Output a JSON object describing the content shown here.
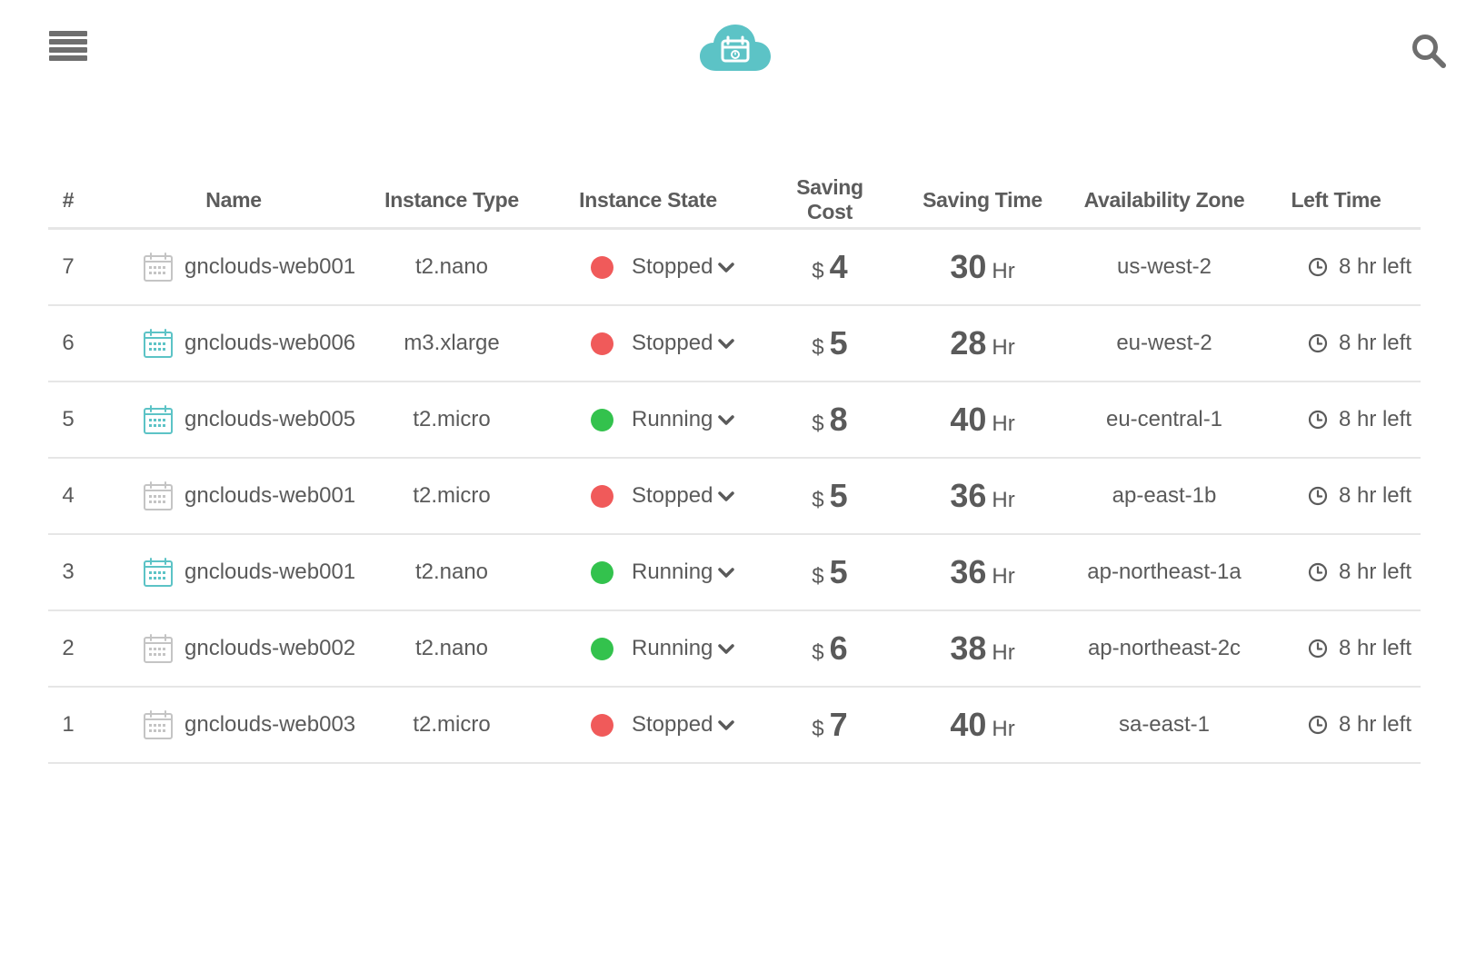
{
  "header": {
    "menu_icon": "hamburger-menu-icon",
    "logo_icon": "cloud-calendar-logo",
    "search_icon": "search-icon",
    "brand_color": "#5cc3c6"
  },
  "table": {
    "columns": [
      "#",
      "Name",
      "Instance Type",
      "Instance State",
      "Saving Cost",
      "Saving Time",
      "Availability Zone",
      "Left Time"
    ],
    "rows": [
      {
        "num": "7",
        "calendar_active": false,
        "name": "gnclouds-web001",
        "type": "t2.nano",
        "state": "Stopped",
        "cost_symbol": "$",
        "cost": "4",
        "time": "30",
        "time_unit": "Hr",
        "zone": "us-west-2",
        "left": "8 hr left"
      },
      {
        "num": "6",
        "calendar_active": true,
        "name": "gnclouds-web006",
        "type": "m3.xlarge",
        "state": "Stopped",
        "cost_symbol": "$",
        "cost": "5",
        "time": "28",
        "time_unit": "Hr",
        "zone": "eu-west-2",
        "left": "8 hr left"
      },
      {
        "num": "5",
        "calendar_active": true,
        "name": "gnclouds-web005",
        "type": "t2.micro",
        "state": "Running",
        "cost_symbol": "$",
        "cost": "8",
        "time": "40",
        "time_unit": "Hr",
        "zone": "eu-central-1",
        "left": "8 hr left"
      },
      {
        "num": "4",
        "calendar_active": false,
        "name": "gnclouds-web001",
        "type": "t2.micro",
        "state": "Stopped",
        "cost_symbol": "$",
        "cost": "5",
        "time": "36",
        "time_unit": "Hr",
        "zone": "ap-east-1b",
        "left": "8 hr left"
      },
      {
        "num": "3",
        "calendar_active": true,
        "name": "gnclouds-web001",
        "type": "t2.nano",
        "state": "Running",
        "cost_symbol": "$",
        "cost": "5",
        "time": "36",
        "time_unit": "Hr",
        "zone": "ap-northeast-1a",
        "left": "8 hr left"
      },
      {
        "num": "2",
        "calendar_active": false,
        "name": "gnclouds-web002",
        "type": "t2.nano",
        "state": "Running",
        "cost_symbol": "$",
        "cost": "6",
        "time": "38",
        "time_unit": "Hr",
        "zone": "ap-northeast-2c",
        "left": "8 hr left"
      },
      {
        "num": "1",
        "calendar_active": false,
        "name": "gnclouds-web003",
        "type": "t2.micro",
        "state": "Stopped",
        "cost_symbol": "$",
        "cost": "7",
        "time": "40",
        "time_unit": "Hr",
        "zone": "sa-east-1",
        "left": "8 hr left"
      }
    ]
  },
  "colors": {
    "running": "#33c24d",
    "stopped": "#f05a5a",
    "calendar_active": "#5cc3c6",
    "calendar_inactive": "#c4c4c4",
    "text": "#5a5a5a"
  }
}
